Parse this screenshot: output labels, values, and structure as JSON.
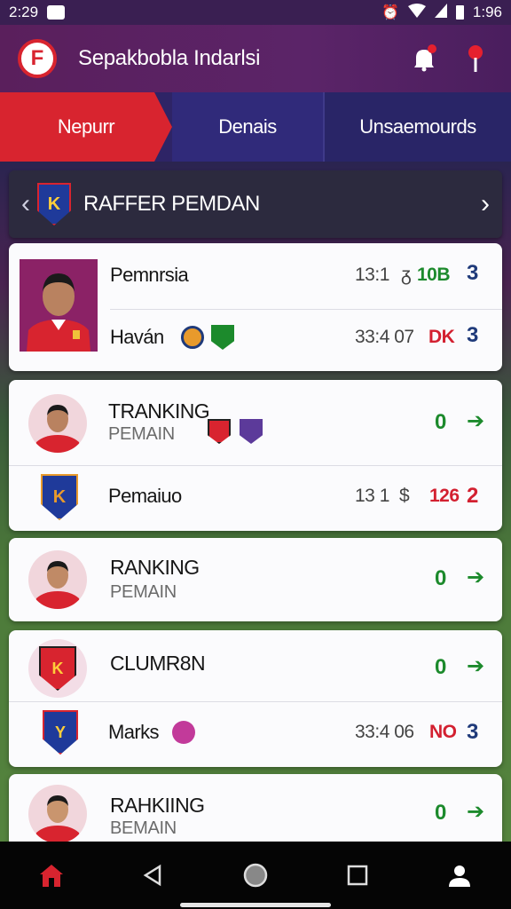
{
  "status": {
    "time": "2:29",
    "battery_time": "1:96"
  },
  "header": {
    "logo_letter": "F",
    "title": "Sepakbobla Indarlsi"
  },
  "tabs": [
    {
      "label": "Nepurr"
    },
    {
      "label": "Denais"
    },
    {
      "label": "Unsaemourds"
    }
  ],
  "section": {
    "title": "RAFFER PEMDAN"
  },
  "top_card": {
    "row1": {
      "name": "Pemnrsia",
      "stat": "13:1",
      "symbol": "ᵹ",
      "value": "10B",
      "rank": "3"
    },
    "row2": {
      "name": "Haván",
      "stat": "33:4 07",
      "value": "DK",
      "rank": "3"
    }
  },
  "card2": {
    "title": "TRANKING",
    "subtitle": "PEMAIN",
    "badge": "0",
    "row2": {
      "name": "Pemaiuo",
      "stat": "13 1",
      "symbol": "$",
      "value": "126",
      "rank": "2"
    }
  },
  "card3": {
    "title": "RANKING",
    "subtitle": "PEMAIN",
    "badge": "0"
  },
  "card4": {
    "title": "CLUMR8N",
    "badge": "0",
    "row2": {
      "name": "Marks",
      "stat": "33:4 06",
      "value": "NO",
      "rank": "3"
    }
  },
  "card5": {
    "title": "RAHKIING",
    "subtitle": "BEMAIN",
    "badge": "0"
  },
  "colors": {
    "accent_red": "#d8242f",
    "header_purple": "#5a1f5c",
    "green": "#1c8a2c",
    "navy": "#1f3a7a"
  }
}
